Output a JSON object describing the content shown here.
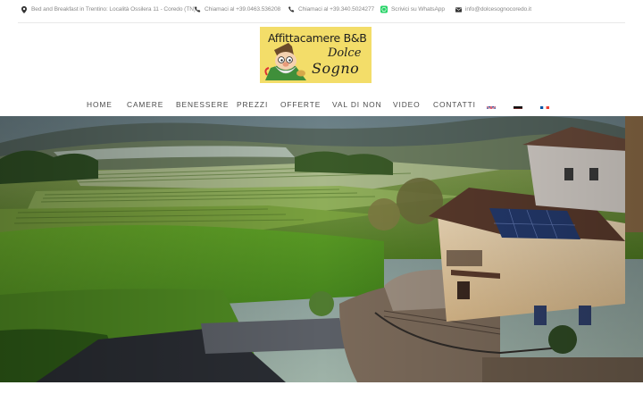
{
  "topbar": {
    "address": "Bed and Breakfast in Trentino: Località Ossilera 11 - Coredo (TN)",
    "phone1": "Chiamaci al +39.0463.536208",
    "phone2": "Chiamaci al +39.340.5024277",
    "whatsapp": "Scrivici su WhatsApp",
    "email": "info@dolcesognocoredo.it",
    "icons": [
      "map-pin-icon",
      "phone-icon",
      "phone-icon",
      "whatsapp-icon",
      "envelope-icon"
    ]
  },
  "logo": {
    "title": "Affittacamere B&B",
    "line2": "Dolce",
    "line3": "Sogno",
    "colors": {
      "background": "#f3dd69",
      "text": "#1e1e1e"
    }
  },
  "nav": {
    "items": [
      "HOME",
      "CAMERE",
      "BENESSERE",
      "PREZZI",
      "OFFERTE",
      "VAL DI NON",
      "VIDEO",
      "CONTATTI"
    ],
    "languages": [
      "english-flag-icon",
      "german-flag-icon",
      "french-flag-icon"
    ]
  },
  "colors": {
    "whatsapp": "#25d366",
    "nav_text": "#4c4c4c",
    "info_text": "#8a8a8a"
  }
}
